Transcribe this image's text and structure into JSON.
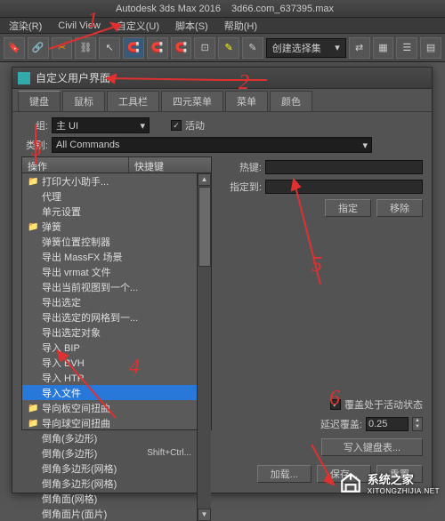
{
  "app": {
    "title": "Autodesk 3ds Max 2016",
    "file": "3d66.com_637395.max"
  },
  "menu": [
    "渲染(R)",
    "Civil View",
    "自定义(U)",
    "脚本(S)",
    "帮助(H)"
  ],
  "toolbar": {
    "selset": "创建选择集"
  },
  "dialog": {
    "title": "自定义用户界面",
    "tabs": [
      "键盘",
      "鼠标",
      "工具栏",
      "四元菜单",
      "菜单",
      "颜色"
    ],
    "group_label": "组:",
    "group_value": "主 UI",
    "active_label": "活动",
    "category_label": "类别:",
    "category_value": "All Commands",
    "list": {
      "headers": [
        "操作",
        "快捷键"
      ],
      "items": [
        {
          "label": "打印大小助手...",
          "folder": true
        },
        {
          "label": "代理"
        },
        {
          "label": "单元设置"
        },
        {
          "label": "弹簧",
          "folder": true
        },
        {
          "label": "弹簧位置控制器"
        },
        {
          "label": "导出 MassFX 场景"
        },
        {
          "label": "导出 vrmat 文件"
        },
        {
          "label": "导出当前视图到一个..."
        },
        {
          "label": "导出选定"
        },
        {
          "label": "导出选定的网格到一..."
        },
        {
          "label": "导出选定对象"
        },
        {
          "label": "导入 BIP"
        },
        {
          "label": "导入 BVH"
        },
        {
          "label": "导入 HTR"
        },
        {
          "label": "导入文件",
          "selected": true
        },
        {
          "label": "导向板空间扭曲",
          "folder": true
        },
        {
          "label": "导向球空间扭曲",
          "folder": true
        },
        {
          "label": "倒角(多边形)"
        },
        {
          "label": "倒角(多边形)",
          "shortcut": "Shift+Ctrl..."
        },
        {
          "label": "倒角多边形(网格)"
        },
        {
          "label": "倒角多边形(网格)"
        },
        {
          "label": "倒角面(网格)"
        },
        {
          "label": "倒角面片(面片)"
        }
      ]
    },
    "hotkey_label": "热键:",
    "assignto_label": "指定到:",
    "assign_btn": "指定",
    "remove_btn": "移除",
    "override_label": "覆盖处于活动状态",
    "delay_label": "延迟覆盖:",
    "delay_value": "0.25",
    "write_btn": "写入键盘表...",
    "load_btn": "加载...",
    "save_btn": "保存...",
    "reset_btn": "重置"
  },
  "watermark": {
    "line1": "系统之家",
    "line2": "XITONGZHIJIA.NET"
  },
  "annotations": [
    "1",
    "2",
    "3",
    "4",
    "5",
    "6"
  ]
}
